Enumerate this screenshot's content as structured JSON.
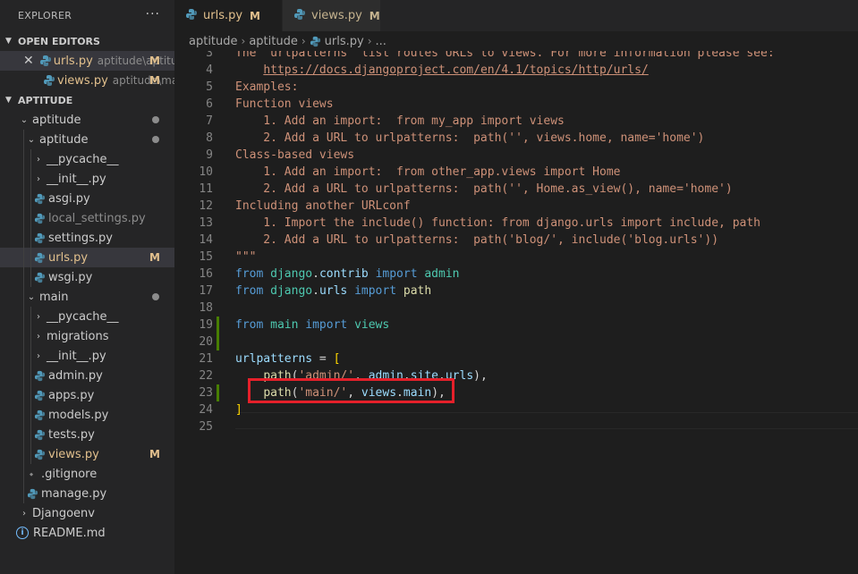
{
  "explorer": {
    "title": "EXPLORER",
    "more": "···",
    "open_editors": {
      "header": "OPEN EDITORS",
      "items": [
        {
          "name": "urls.py",
          "desc": "aptitude\\aptitude",
          "badge": "M"
        },
        {
          "name": "views.py",
          "desc": "aptitude\\main",
          "badge": "M"
        }
      ]
    },
    "workspace": {
      "header": "APTITUDE",
      "items": [
        {
          "name": "aptitude"
        },
        {
          "name": "aptitude"
        },
        {
          "name": "__pycache__"
        },
        {
          "name": "__init__.py"
        },
        {
          "name": "asgi.py"
        },
        {
          "name": "local_settings.py"
        },
        {
          "name": "settings.py"
        },
        {
          "name": "urls.py",
          "badge": "M"
        },
        {
          "name": "wsgi.py"
        },
        {
          "name": "main"
        },
        {
          "name": "__pycache__"
        },
        {
          "name": "migrations"
        },
        {
          "name": "__init__.py"
        },
        {
          "name": "admin.py"
        },
        {
          "name": "apps.py"
        },
        {
          "name": "models.py"
        },
        {
          "name": "tests.py"
        },
        {
          "name": "views.py",
          "badge": "M"
        },
        {
          "name": ".gitignore"
        },
        {
          "name": "manage.py"
        },
        {
          "name": "Djangoenv"
        },
        {
          "name": "README.md"
        }
      ]
    }
  },
  "tabs": [
    {
      "label": "urls.py",
      "badge": "M",
      "active": true
    },
    {
      "label": "views.py",
      "badge": "M",
      "active": false
    }
  ],
  "breadcrumb": {
    "part1": "aptitude",
    "part2": "aptitude",
    "file": "urls.py",
    "more": "..."
  },
  "editor": {
    "lines": [
      {
        "n": "3",
        "t": "The `urlpatterns` list routes URLs to views. For more information please see:"
      },
      {
        "n": "4",
        "t": "    https://docs.djangoproject.com/en/4.1/topics/http/urls/"
      },
      {
        "n": "5",
        "t": "Examples:"
      },
      {
        "n": "6",
        "t": "Function views"
      },
      {
        "n": "7",
        "t": "    1. Add an import:  from my_app import views"
      },
      {
        "n": "8",
        "t": "    2. Add a URL to urlpatterns:  path('', views.home, name='home')"
      },
      {
        "n": "9",
        "t": "Class-based views"
      },
      {
        "n": "10",
        "t": "    1. Add an import:  from other_app.views import Home"
      },
      {
        "n": "11",
        "t": "    2. Add a URL to urlpatterns:  path('', Home.as_view(), name='home')"
      },
      {
        "n": "12",
        "t": "Including another URLconf"
      },
      {
        "n": "13",
        "t": "    1. Import the include() function: from django.urls import include, path"
      },
      {
        "n": "14",
        "t": "    2. Add a URL to urlpatterns:  path('blog/', include('blog.urls'))"
      },
      {
        "n": "15",
        "t": "\"\"\""
      },
      {
        "n": "16",
        "t": "from django.contrib import admin"
      },
      {
        "n": "17",
        "t": "from django.urls import path"
      },
      {
        "n": "18",
        "t": ""
      },
      {
        "n": "19",
        "t": "from main import views"
      },
      {
        "n": "20",
        "t": ""
      },
      {
        "n": "21",
        "t": "urlpatterns = ["
      },
      {
        "n": "22",
        "t": "    path('admin/', admin.site.urls),"
      },
      {
        "n": "23",
        "t": "    path('main/', views.main),"
      },
      {
        "n": "24",
        "t": "]"
      },
      {
        "n": "25",
        "t": ""
      }
    ]
  },
  "colors": {
    "modified": "#e2c08d",
    "keyword": "#569cd6",
    "string": "#ce9178",
    "module": "#4ec9b0",
    "function": "#dcdcaa",
    "variable": "#9cdcfe",
    "highlight_box": "#e5202a",
    "gutter_added": "#487e02"
  }
}
